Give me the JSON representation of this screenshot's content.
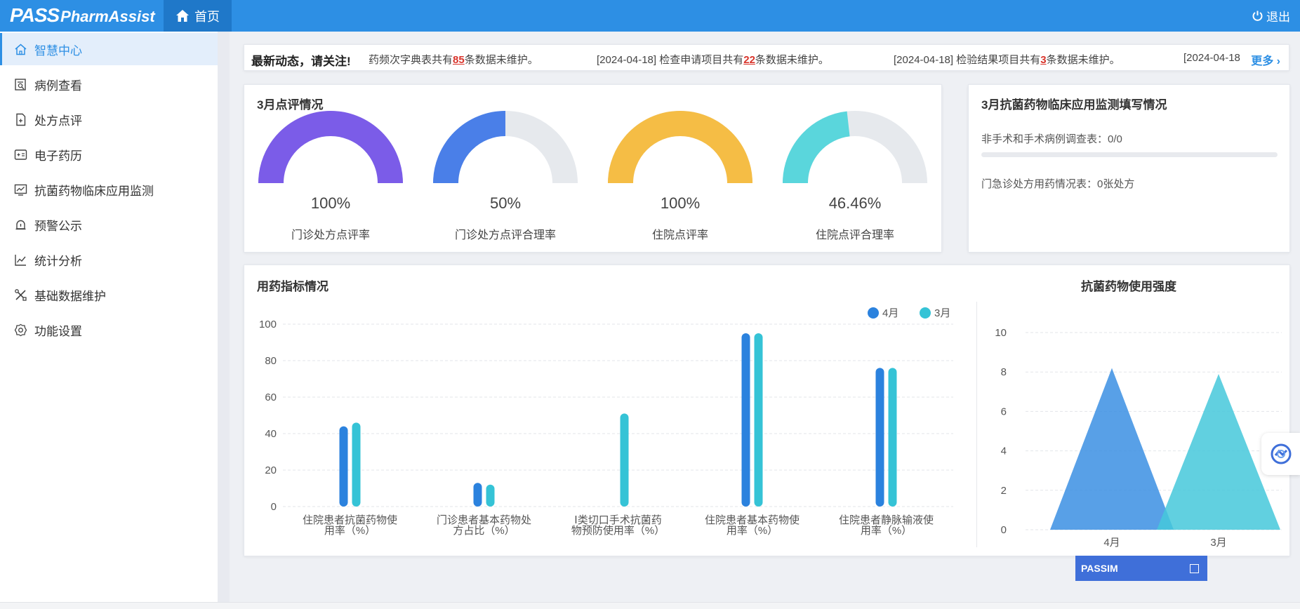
{
  "header": {
    "logo_part1": "PASS",
    "logo_part2": "PharmAssist",
    "home_tab": "首页",
    "logout": "退出"
  },
  "sidebar": {
    "items": [
      {
        "label": "智慧中心",
        "icon": "home-icon",
        "active": true
      },
      {
        "label": "病例查看",
        "icon": "case-search-icon"
      },
      {
        "label": "处方点评",
        "icon": "prescription-icon"
      },
      {
        "label": "电子药历",
        "icon": "medical-record-icon"
      },
      {
        "label": "抗菌药物临床应用监测",
        "icon": "monitor-chart-icon"
      },
      {
        "label": "预警公示",
        "icon": "alarm-icon"
      },
      {
        "label": "统计分析",
        "icon": "trend-icon"
      },
      {
        "label": "基础数据维护",
        "icon": "tools-icon"
      },
      {
        "label": "功能设置",
        "icon": "gear-icon"
      }
    ]
  },
  "notice": {
    "lead": "最新动态，请关注!",
    "messages": [
      {
        "prefix": "药频次字典表共有",
        "num": "85",
        "suffix": "条数据未维护。"
      },
      {
        "prefix": "[2024-04-18]  检查申请项目共有",
        "num": "22",
        "suffix": "条数据未维护。"
      },
      {
        "prefix": "[2024-04-18]  检验结果项目共有",
        "num": "3",
        "suffix": "条数据未维护。"
      },
      {
        "prefix": "[2024-04-18",
        "num": "",
        "suffix": ""
      }
    ],
    "more": "更多"
  },
  "review": {
    "title": "3月点评情况",
    "gauges": [
      {
        "value": "100%",
        "label": "门诊处方点评率",
        "fraction": 1.0,
        "color": "#7b5ce8"
      },
      {
        "value": "50%",
        "label": "门诊处方点评合理率",
        "fraction": 0.5,
        "color": "#4a7fe8"
      },
      {
        "value": "100%",
        "label": "住院点评率",
        "fraction": 1.0,
        "color": "#f5bd45"
      },
      {
        "value": "46.46%",
        "label": "住院点评合理率",
        "fraction": 0.4646,
        "color": "#5ad6dc"
      }
    ]
  },
  "antibiotic_monitor": {
    "title": "3月抗菌药物临床应用监测填写情况",
    "line1": "非手术和手术病例调查表：0/0",
    "line2": "门急诊处方用药情况表：0张处方"
  },
  "medication": {
    "title": "用药指标情况"
  },
  "intensity": {
    "title": "抗菌药物使用强度"
  },
  "chart_data": [
    {
      "type": "bar",
      "title": "用药指标情况",
      "categories": [
        "住院患者抗菌药物使\n用率（%）",
        "门诊患者基本药物处\n方占比（%）",
        "Ⅰ类切口手术抗菌药\n物预防使用率（%）",
        "住院患者基本药物使\n用率（%）",
        "住院患者静脉输液使\n用率（%）"
      ],
      "series": [
        {
          "name": "4月",
          "color": "#2b82de",
          "values": [
            44,
            13,
            0,
            95,
            76
          ]
        },
        {
          "name": "3月",
          "color": "#35c3d6",
          "values": [
            46,
            12,
            51,
            95,
            76
          ]
        }
      ],
      "ylim": [
        0,
        100
      ],
      "yticks": [
        0,
        20,
        40,
        60,
        80,
        100
      ],
      "grid": true,
      "legend": "top-right"
    },
    {
      "type": "area",
      "title": "抗菌药物使用强度",
      "categories": [
        "4月",
        "3月"
      ],
      "values": [
        8.2,
        7.9
      ],
      "colors": [
        "#3b8fe3",
        "#45c8da"
      ],
      "ylim": [
        0,
        10
      ],
      "yticks": [
        0,
        2,
        4,
        6,
        8,
        10
      ],
      "grid": true
    }
  ],
  "passim": {
    "label": "PASSIM"
  }
}
